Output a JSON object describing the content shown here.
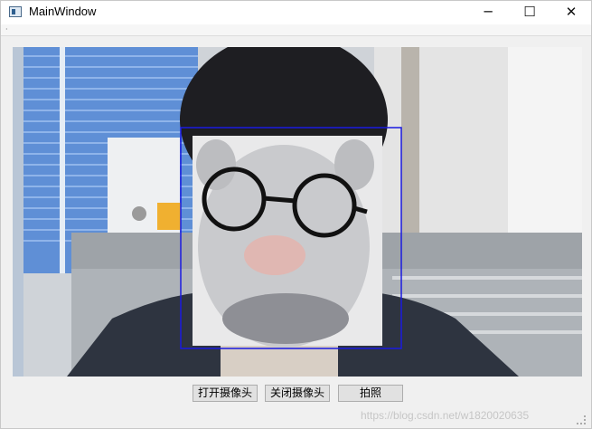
{
  "window": {
    "title": "MainWindow",
    "controls": {
      "minimize": "─",
      "maximize": "☐",
      "close": "✕"
    }
  },
  "menubar": {
    "marker": "·"
  },
  "camera_view": {
    "detection_box_color": "#1a1ae0"
  },
  "buttons": {
    "open_camera": "打开摄像头",
    "close_camera": "关闭摄像头",
    "take_photo": "拍照"
  },
  "watermark": "https://blog.csdn.net/w1820020635"
}
